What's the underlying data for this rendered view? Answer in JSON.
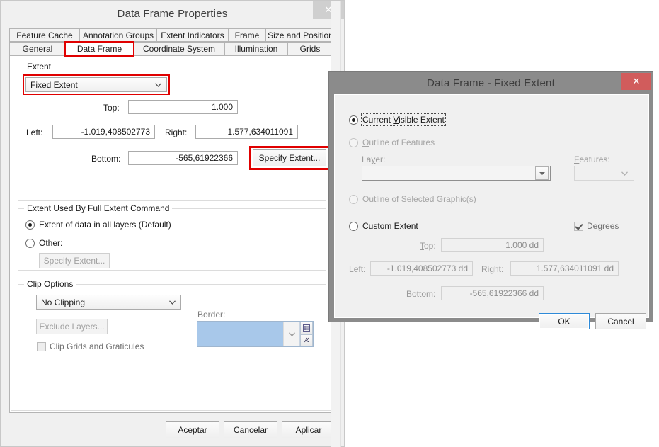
{
  "dialog1": {
    "title": "Data Frame Properties",
    "close_label": "✕",
    "tabs_row1": [
      {
        "label": "Feature Cache"
      },
      {
        "label": "Annotation Groups"
      },
      {
        "label": "Extent Indicators"
      },
      {
        "label": "Frame"
      },
      {
        "label": "Size and Position"
      }
    ],
    "tabs_row2": [
      {
        "label": "General"
      },
      {
        "label": "Data Frame"
      },
      {
        "label": "Coordinate System"
      },
      {
        "label": "Illumination"
      },
      {
        "label": "Grids"
      }
    ],
    "selected_tab": "Data Frame",
    "extent_group": {
      "title": "Extent",
      "mode_value": "Fixed Extent",
      "top_label": "Top:",
      "top_value": "1.000",
      "left_label": "Left:",
      "left_value": "-1.019,408502773",
      "right_label": "Right:",
      "right_value": "1.577,634011091",
      "bottom_label": "Bottom:",
      "bottom_value": "-565,61922366",
      "specify_extent_label": "Specify Extent..."
    },
    "full_extent_group": {
      "title": "Extent Used By Full Extent Command",
      "option_default": "Extent of data in all layers (Default)",
      "option_other": "Other:",
      "specify_extent_label": "Specify Extent..."
    },
    "clip_group": {
      "title": "Clip Options",
      "clip_value": "No Clipping",
      "exclude_layers_label": "Exclude Layers...",
      "clip_grids_label": "Clip Grids and Graticules",
      "border_label": "Border:",
      "border_color": "#a8c8ea",
      "palette_icon": "palette-icon",
      "more-icon": "more-styles-icon"
    },
    "buttons": {
      "ok": "Aceptar",
      "cancel": "Cancelar",
      "apply": "Aplicar"
    }
  },
  "dialog2": {
    "title": "Data Frame - Fixed Extent",
    "close_label": "✕",
    "options": {
      "current_visible_pre": "Current ",
      "current_visible_accel": "V",
      "current_visible_post": "isible Extent",
      "outline_features_accel": "O",
      "outline_features_post": "utline of Features",
      "layer_label_pre": "La",
      "layer_label_accel": "y",
      "layer_label_post": "er:",
      "layer_value": "",
      "features_label_pre": "",
      "features_label_accel": "F",
      "features_label_post": "eatures:",
      "features_value": "",
      "outline_graphics_pre": "Outline of Selected ",
      "outline_graphics_accel": "G",
      "outline_graphics_post": "raphic(s)",
      "custom_extent_pre": "Custom E",
      "custom_extent_accel": "x",
      "custom_extent_post": "tent",
      "degrees_pre": "",
      "degrees_accel": "D",
      "degrees_post": "egrees"
    },
    "custom": {
      "top_label_pre": "",
      "top_label_accel": "T",
      "top_label_post": "op:",
      "top_value": "1.000 dd",
      "left_label_pre": "L",
      "left_label_accel": "e",
      "left_label_post": "ft:",
      "left_value": "-1.019,408502773 dd",
      "right_label_pre": "",
      "right_label_accel": "R",
      "right_label_post": "ight:",
      "right_value": "1.577,634011091 dd",
      "bottom_label_pre": "Botto",
      "bottom_label_accel": "m",
      "bottom_label_post": ":",
      "bottom_value": "-565,61922366 dd"
    },
    "buttons": {
      "ok": "OK",
      "cancel": "Cancel"
    }
  },
  "theme": {
    "accent_red": "#e00000",
    "close_active": "#d15c5c",
    "close_inactive": "#cfcfcf",
    "frame_gray": "#8b8b8b"
  }
}
